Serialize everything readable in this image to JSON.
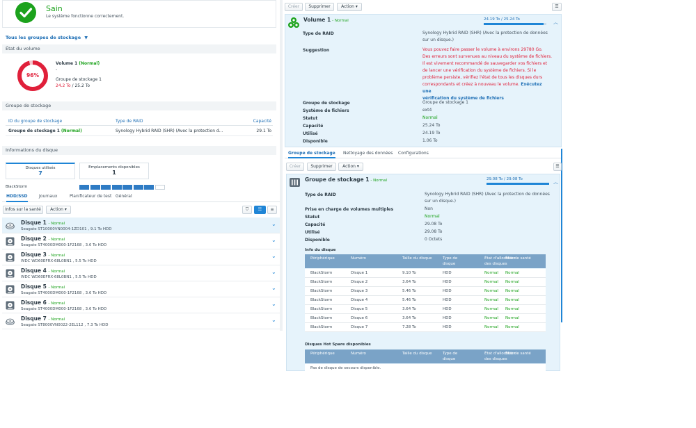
{
  "status": {
    "title": "Sain",
    "message": "Le système fonctionne correctement."
  },
  "groups_dropdown": "Tous les groupes de stockage",
  "volume_state": {
    "section": "État du volume",
    "percent": "96%",
    "percent_value": 96,
    "name": "Volume 1",
    "status": "(Normal)",
    "dash": "-",
    "group": "Groupe de stockage 1",
    "used": "24.2 To",
    "sep": " / ",
    "total": "25.2 To"
  },
  "storage_group": {
    "section": "Groupe de stockage",
    "col_id": "ID du groupe de stockage",
    "col_type": "Type de RAID",
    "col_cap": "Capacité",
    "row_id": "Groupe de stockage 1",
    "row_status": "(Normal)",
    "row_type": "Synology Hybrid RAID (SHR) (Avec la protection d...",
    "row_cap": "29.1 To"
  },
  "disk_info": {
    "section": "Informations du disque",
    "used_label": "Disques utilisés",
    "used_value": "7",
    "free_label": "Emplacements disponibles",
    "free_value": "1",
    "device": "BlackStorm",
    "slots_used": 7,
    "slots_total": 8
  },
  "lower_tabs": [
    "HDD/SSD",
    "Journaux",
    "Planificateur de test",
    "Général"
  ],
  "lower_toolbar": {
    "health": "Infos sur la santé",
    "action": "Action"
  },
  "disks": [
    {
      "name": "Disque 1",
      "status": "- Normal",
      "model": "Seagate ST10000VN0004-1ZD101 , 9.1 To HDD",
      "icon": "hdd-open-icon",
      "selected": true
    },
    {
      "name": "Disque 2",
      "status": "- Normal",
      "model": "Seagate ST4000DM000-1F2168 , 3.6 To HDD",
      "icon": "hdd-icon",
      "selected": false
    },
    {
      "name": "Disque 3",
      "status": "- Normal",
      "model": "WDC WD60EFRX-68L0BN1 , 5.5 To HDD",
      "icon": "hdd-icon",
      "selected": false
    },
    {
      "name": "Disque 4",
      "status": "- Normal",
      "model": "WDC WD60EFRX-68L0BN1 , 5.5 To HDD",
      "icon": "hdd-icon",
      "selected": false
    },
    {
      "name": "Disque 5",
      "status": "- Normal",
      "model": "Seagate ST4000DM000-1F2168 , 3.6 To HDD",
      "icon": "hdd-icon",
      "selected": false
    },
    {
      "name": "Disque 6",
      "status": "- Normal",
      "model": "Seagate ST4000DM000-1F2168 , 3.6 To HDD",
      "icon": "hdd-icon",
      "selected": false
    },
    {
      "name": "Disque 7",
      "status": "- Normal",
      "model": "Seagate ST8000VN0022-2EL112 , 7.3 To HDD",
      "icon": "hdd-open-icon",
      "selected": false
    }
  ],
  "top_toolbar": {
    "create": "Créer",
    "delete": "Supprimer",
    "action": "Action"
  },
  "volume_panel": {
    "name": "Volume 1",
    "status": "- Normal",
    "usage": "24.19 To / 25.24 To",
    "usage_fraction": 0.958,
    "raid_label": "Type de RAID",
    "raid_value": "Synology Hybrid RAID (SHR) (Avec la protection de données sur un disque.)",
    "suggest_label": "Suggestion",
    "suggest_lines": [
      "Vous pouvez faire passer le volume à environs 29780 Go.",
      "Des erreurs sont survenues au niveau du système de fichiers.",
      "Il est vivement recommandé de sauvegarder vos fichiers et",
      "de lancer une vérification du système de fichiers. Si le",
      "problème persiste, vérifiez l'état de tous les disques durs",
      "correspondants et créez à nouveau le volume."
    ],
    "suggest_link_a": "Exécutez une",
    "suggest_link_b": "vérification du système de fichiers",
    "group_label": "Groupe de stockage",
    "group_value": "Groupe de stockage 1",
    "fs_label": "Système de fichiers",
    "fs_value": "ext4",
    "status_label": "Statut",
    "status_value": "Normal",
    "cap_label": "Capacité",
    "cap_value": "25.24 To",
    "used_label": "Utilisé",
    "used_value": "24.19 To",
    "free_label": "Disponible",
    "free_value": "1.06 To"
  },
  "mid_tabs": [
    "Groupe de stockage",
    "Nettoyage des données",
    "Configurations"
  ],
  "group_panel": {
    "name": "Groupe de stockage 1",
    "status": "- Normal",
    "usage": "29.08 To / 29.08 To",
    "usage_fraction": 1.0,
    "raid_label": "Type de RAID",
    "raid_value": "Synology Hybrid RAID (SHR) (Avec la protection de données sur un disque.)",
    "multi_label": "Prise en charge de volumes multiples",
    "multi_value": "Non",
    "status_label": "Statut",
    "status_value": "Normal",
    "cap_label": "Capacité",
    "cap_value": "29.08 To",
    "used_label": "Utilisé",
    "used_value": "29.08 To",
    "free_label": "Disponible",
    "free_value": "0 Octets",
    "disk_info_title": "Info du disque",
    "cols": [
      "Périphérique",
      "Numéro",
      "Taille du disque",
      "Type de disque",
      "État d'allocation des disques",
      "État de santé"
    ],
    "rows": [
      [
        "BlackStorm",
        "Disque 1",
        "9.10 To",
        "HDD",
        "Normal",
        "Normal"
      ],
      [
        "BlackStorm",
        "Disque 2",
        "3.64 To",
        "HDD",
        "Normal",
        "Normal"
      ],
      [
        "BlackStorm",
        "Disque 3",
        "5.46 To",
        "HDD",
        "Normal",
        "Normal"
      ],
      [
        "BlackStorm",
        "Disque 4",
        "5.46 To",
        "HDD",
        "Normal",
        "Normal"
      ],
      [
        "BlackStorm",
        "Disque 5",
        "3.64 To",
        "HDD",
        "Normal",
        "Normal"
      ],
      [
        "BlackStorm",
        "Disque 6",
        "3.64 To",
        "HDD",
        "Normal",
        "Normal"
      ],
      [
        "BlackStorm",
        "Disque 7",
        "7.28 To",
        "HDD",
        "Normal",
        "Normal"
      ]
    ],
    "spare_title": "Disques Hot Spare disponibles",
    "spare_empty": "Pas de disque de secours disponible."
  },
  "colors": {
    "accent": "#1f85d6",
    "ok": "#1ca21c",
    "error": "#e0203a",
    "panel": "#e6f3fb"
  }
}
